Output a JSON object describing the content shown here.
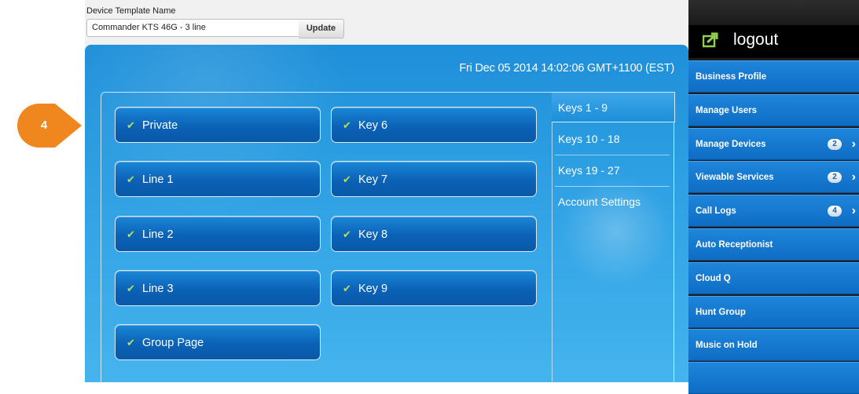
{
  "callout": {
    "number": "4"
  },
  "template": {
    "label": "Device Template Name",
    "value": "Commander KTS 46G - 3 line",
    "update_label": "Update"
  },
  "panel": {
    "datetime": "Fri Dec 05 2014 14:02:06 GMT+1100 (EST)",
    "keys": [
      {
        "label": "Private",
        "icon": "phone-handset-icon"
      },
      {
        "label": "Line 1",
        "icon": "phone-handset-icon"
      },
      {
        "label": "Line 2",
        "icon": "phone-handset-icon"
      },
      {
        "label": "Line 3",
        "icon": "phone-handset-icon"
      },
      {
        "label": "Group Page",
        "icon": "phone-handset-icon"
      },
      {
        "label": "Key 6",
        "icon": "phone-handset-icon"
      },
      {
        "label": "Key 7",
        "icon": "phone-handset-icon"
      },
      {
        "label": "Key 8",
        "icon": "phone-handset-icon"
      },
      {
        "label": "Key 9",
        "icon": "phone-handset-icon"
      }
    ],
    "tabs": [
      {
        "label": "Keys 1 - 9",
        "active": true
      },
      {
        "label": "Keys 10 - 18",
        "active": false
      },
      {
        "label": "Keys 19 - 27",
        "active": false
      },
      {
        "label": "Account Settings",
        "active": false
      }
    ]
  },
  "sidebar": {
    "logout_label": "logout",
    "items": [
      {
        "label": "Business Profile"
      },
      {
        "label": "Manage Users"
      },
      {
        "label": "Manage Devices",
        "badge": "2"
      },
      {
        "label": "Viewable Services",
        "badge": "2"
      },
      {
        "label": "Call Logs",
        "badge": "4"
      },
      {
        "label": "Auto Receptionist"
      },
      {
        "label": "Cloud Q"
      },
      {
        "label": "Hunt Group"
      },
      {
        "label": "Music on Hold"
      }
    ]
  },
  "colors": {
    "accent": "#1e86da",
    "callout": "#f0861e",
    "handset": "#b6e05a"
  }
}
